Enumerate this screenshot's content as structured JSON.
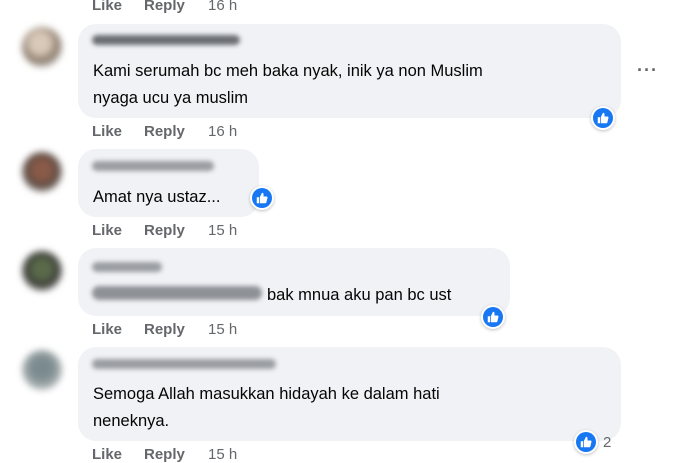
{
  "comments": [
    {
      "actions": {
        "like": "Like",
        "reply": "Reply",
        "time": "16 h"
      }
    },
    {
      "text_lines": [
        "Kami serumah bc meh baka nyak, inik ya non Muslim",
        "nyaga ucu ya muslim"
      ],
      "actions": {
        "like": "Like",
        "reply": "Reply",
        "time": "16 h"
      }
    },
    {
      "text_lines": [
        "Amat nya ustaz..."
      ],
      "actions": {
        "like": "Like",
        "reply": "Reply",
        "time": "15 h"
      }
    },
    {
      "text_lines": [
        "bak mnua aku pan bc ust"
      ],
      "actions": {
        "like": "Like",
        "reply": "Reply",
        "time": "15 h"
      }
    },
    {
      "text_lines": [
        "Semoga Allah masukkan hidayah ke dalam hati",
        "neneknya."
      ],
      "reaction_count": "2",
      "actions": {
        "like": "Like",
        "reply": "Reply",
        "time": "15 h"
      }
    }
  ],
  "icons": {
    "reaction": "like-thumb-icon",
    "more": "more-options-icon"
  },
  "colors": {
    "bubble": "#f0f2f5",
    "meta": "#65676b",
    "accent": "#1877f2",
    "text": "#050505"
  }
}
